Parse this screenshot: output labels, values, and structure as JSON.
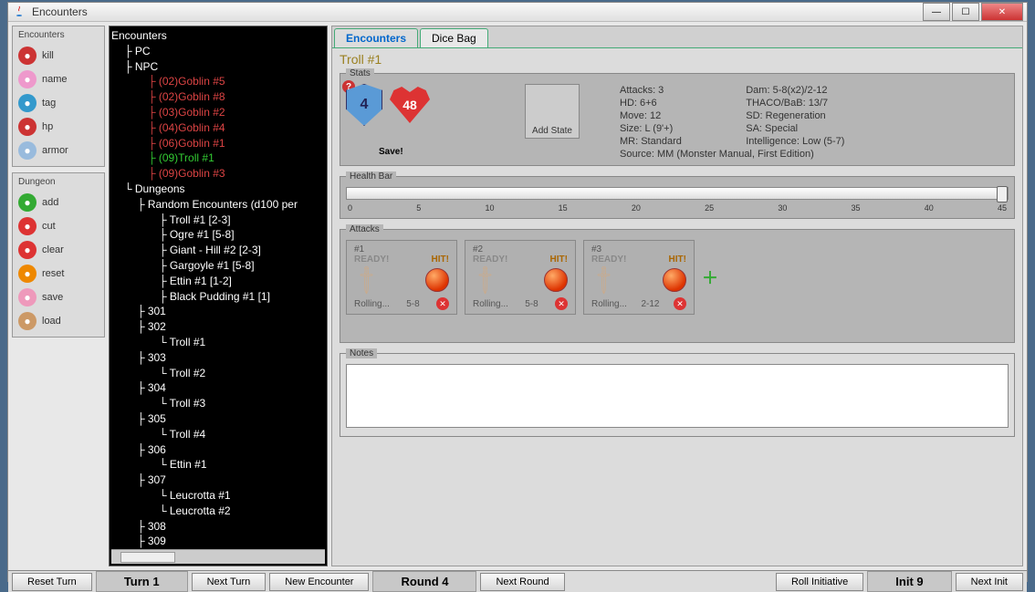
{
  "window_title": "Encounters",
  "toolbox_encounters": {
    "title": "Encounters",
    "items": [
      {
        "label": "kill",
        "icon": "kill-icon",
        "color": "#c33"
      },
      {
        "label": "name",
        "icon": "name-icon",
        "color": "#e9c"
      },
      {
        "label": "tag",
        "icon": "tag-icon",
        "color": "#39c"
      },
      {
        "label": "hp",
        "icon": "hp-icon",
        "color": "#c33"
      },
      {
        "label": "armor",
        "icon": "armor-icon",
        "color": "#9bd"
      }
    ]
  },
  "toolbox_dungeon": {
    "title": "Dungeon",
    "items": [
      {
        "label": "add",
        "icon": "add-icon",
        "color": "#3a3"
      },
      {
        "label": "cut",
        "icon": "cut-icon",
        "color": "#d33"
      },
      {
        "label": "clear",
        "icon": "clear-icon",
        "color": "#d33"
      },
      {
        "label": "reset",
        "icon": "reset-icon",
        "color": "#e80"
      },
      {
        "label": "save",
        "icon": "save-icon",
        "color": "#e9b"
      },
      {
        "label": "load",
        "icon": "load-icon",
        "color": "#c96"
      }
    ]
  },
  "tree": {
    "root": "Encounters",
    "pc": "PC",
    "npc": "NPC",
    "npcs": [
      {
        "label": "(02)Goblin #5",
        "cls": "tree-red"
      },
      {
        "label": "(02)Goblin #8",
        "cls": "tree-red"
      },
      {
        "label": "(03)Goblin #2",
        "cls": "tree-red"
      },
      {
        "label": "(04)Goblin #4",
        "cls": "tree-red"
      },
      {
        "label": "(06)Goblin #1",
        "cls": "tree-red"
      },
      {
        "label": "(09)Troll #1",
        "cls": "tree-green"
      },
      {
        "label": "(09)Goblin #3",
        "cls": "tree-red"
      }
    ],
    "dungeons": "Dungeons",
    "random_title": "Random Encounters (d100 per",
    "random": [
      "Troll #1 [2-3]",
      "Ogre #1 [5-8]",
      "Giant - Hill #2 [2-3]",
      "Gargoyle #1 [5-8]",
      "Ettin #1 [1-2]",
      "Black Pudding #1 [1]"
    ],
    "rooms": [
      {
        "n": "301",
        "c": []
      },
      {
        "n": "302",
        "c": [
          "Troll #1"
        ]
      },
      {
        "n": "303",
        "c": [
          "Troll #2"
        ]
      },
      {
        "n": "304",
        "c": [
          "Troll #3"
        ]
      },
      {
        "n": "305",
        "c": [
          "Troll #4"
        ]
      },
      {
        "n": "306",
        "c": [
          "Ettin #1"
        ]
      },
      {
        "n": "307",
        "c": [
          "Leucrotta #1",
          "Leucrotta #2"
        ]
      },
      {
        "n": "308",
        "c": []
      },
      {
        "n": "309",
        "c": []
      }
    ]
  },
  "tabs": {
    "active": "Encounters",
    "other": "Dice Bag"
  },
  "detail": {
    "title": "Troll #1",
    "ac": "4",
    "hp": "48",
    "save": "Save!",
    "add_state": "Add State",
    "stats_left": [
      "Attacks: 3",
      "HD: 6+6",
      "Move: 12",
      "Size: L (9'+)",
      "MR: Standard"
    ],
    "stats_right": [
      "Dam: 5-8(x2)/2-12",
      "THACO/BaB: 13/7",
      "SD: Regeneration",
      "SA: Special",
      "Intelligence: Low (5-7)"
    ],
    "source": "Source: MM (Monster Manual, First Edition)",
    "health_label": "Health Bar",
    "ruler": [
      "0",
      "5",
      "10",
      "15",
      "20",
      "25",
      "30",
      "35",
      "40",
      "45"
    ],
    "attacks_label": "Attacks",
    "attacks": [
      {
        "n": "#1",
        "ready": "READY!",
        "hit": "HIT!",
        "roll": "Rolling...",
        "dmg": "5-8"
      },
      {
        "n": "#2",
        "ready": "READY!",
        "hit": "HIT!",
        "roll": "Rolling...",
        "dmg": "5-8"
      },
      {
        "n": "#3",
        "ready": "READY!",
        "hit": "HIT!",
        "roll": "Rolling...",
        "dmg": "2-12"
      }
    ],
    "notes_label": "Notes"
  },
  "bottom": {
    "reset_turn": "Reset Turn",
    "turn": "Turn 1",
    "next_turn": "Next Turn",
    "new_encounter": "New Encounter",
    "round": "Round 4",
    "next_round": "Next Round",
    "roll_init": "Roll Initiative",
    "init": "Init 9",
    "next_init": "Next Init"
  }
}
